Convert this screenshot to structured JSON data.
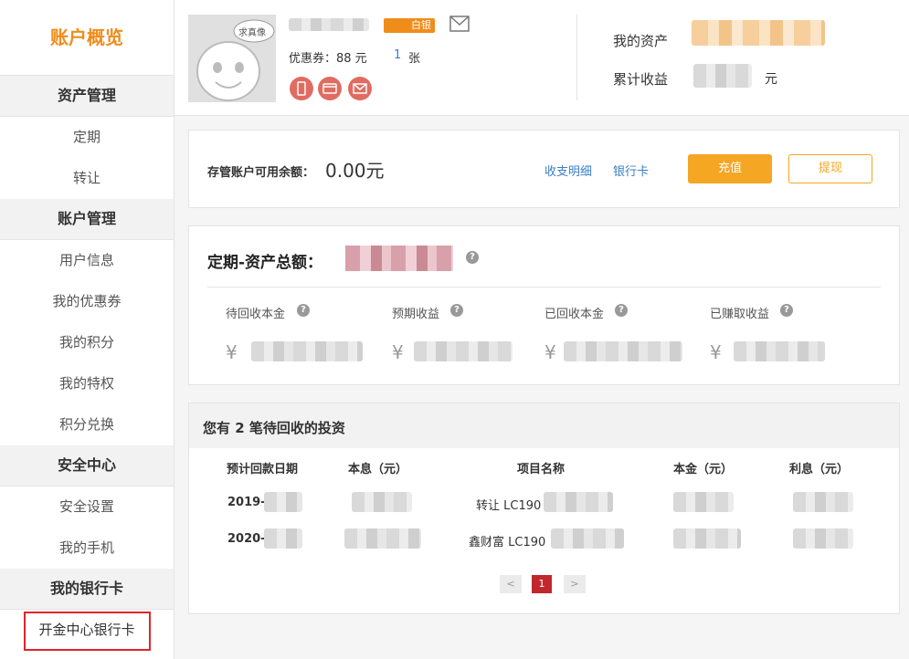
{
  "sidebar": {
    "title": "账户概览",
    "groups": [
      {
        "label": "资产管理",
        "items": [
          "定期",
          "转让"
        ]
      },
      {
        "label": "账户管理",
        "items": [
          "用户信息",
          "我的优惠券",
          "我的积分",
          "我的特权",
          "积分兑换"
        ]
      },
      {
        "label": "安全中心",
        "items": [
          "安全设置",
          "我的手机"
        ]
      },
      {
        "label": "我的银行卡",
        "items": [
          "开金中心银行卡"
        ]
      }
    ]
  },
  "profile": {
    "avatar_caption": "求真像",
    "level_badge": "白银",
    "coupon_label": "优惠券：88 元",
    "coupon_count": "1",
    "coupon_unit": "张",
    "my_assets_label": "我的资产",
    "total_income_label": "累计收益",
    "total_income_unit": "元"
  },
  "balance": {
    "label": "存管账户可用余额：",
    "amount": "0.00元",
    "links": [
      "收支明细",
      "银行卡"
    ],
    "pay_button": "充值",
    "withdraw_button": "提现"
  },
  "regular": {
    "title": "定期-资产总额：",
    "stats": [
      {
        "label": "待回收本金",
        "currency": "¥"
      },
      {
        "label": "预期收益",
        "currency": "¥"
      },
      {
        "label": "已回收本金",
        "currency": "¥"
      },
      {
        "label": "已赚取收益",
        "currency": "¥"
      }
    ]
  },
  "investments": {
    "title": "您有 2 笔待回收的投资",
    "headers": [
      "预计回款日期",
      "本息（元）",
      "项目名称",
      "本金（元）",
      "利息（元）"
    ],
    "rows": [
      {
        "date": "2019-",
        "project": "转让 LC190"
      },
      {
        "date": "2020-",
        "project": "鑫财富 LC190"
      }
    ],
    "pagination": {
      "prev": "<",
      "current": "1",
      "next": ">"
    }
  },
  "colors": {
    "accent": "#f08c1a",
    "button": "#f5a623",
    "link": "#3b7fc4",
    "highlight": "#e0242a"
  }
}
